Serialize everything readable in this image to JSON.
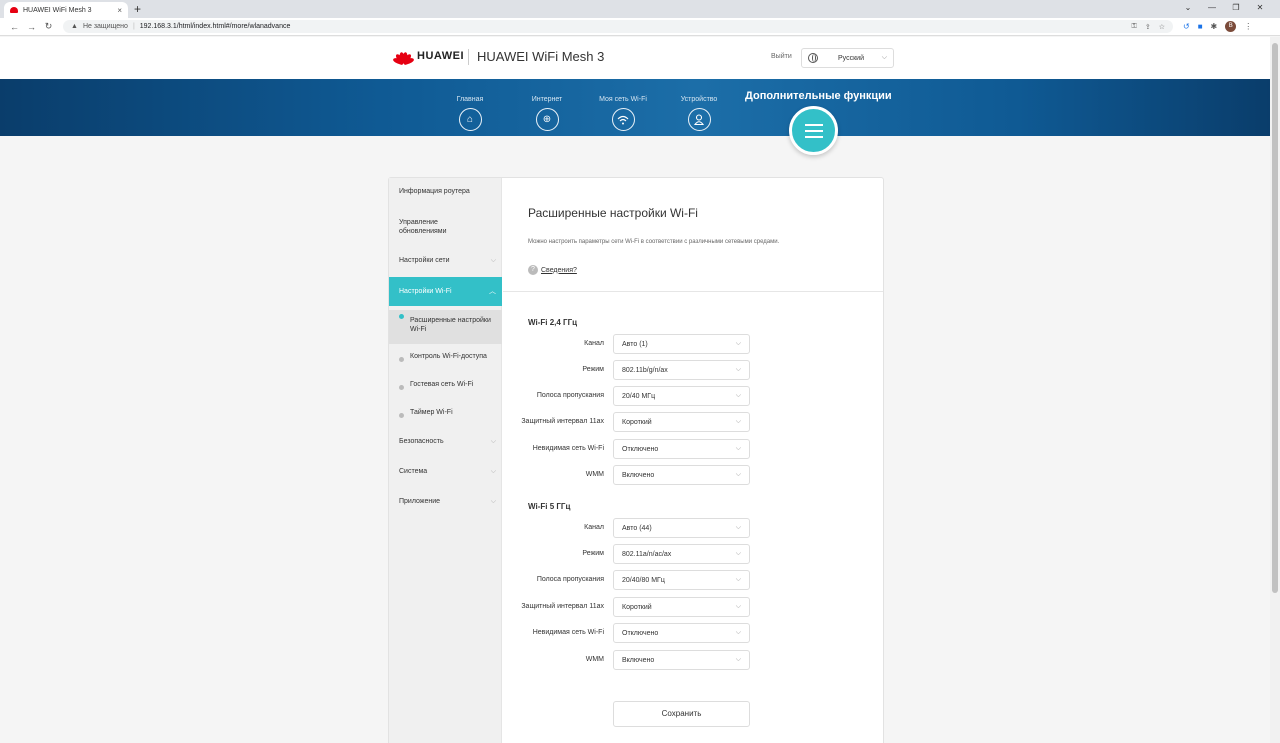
{
  "browser": {
    "tab_title": "HUAWEI WiFi Mesh 3",
    "tab_close": "×",
    "new_tab": "+",
    "security_label": "Не защищено",
    "url": "192.168.3.1/html/index.html#/more/wlanadvance",
    "profile_initial": "B"
  },
  "header": {
    "brand": "HUAWEI",
    "product": "HUAWEI WiFi Mesh 3",
    "logout": "Выйти",
    "language": "Русский"
  },
  "nav": {
    "items": [
      {
        "label": "Главная",
        "icon": "home-icon"
      },
      {
        "label": "Интернет",
        "icon": "globe-icon"
      },
      {
        "label": "Моя сеть Wi-Fi",
        "icon": "wifi-icon"
      },
      {
        "label": "Устройство",
        "icon": "user-icon"
      }
    ],
    "active_label": "Дополнительные функции"
  },
  "sidebar": {
    "items": [
      {
        "label": "Информация роутера"
      },
      {
        "label": "Управление обновлениями"
      },
      {
        "label": "Настройки сети"
      },
      {
        "label": "Настройки Wi-Fi"
      },
      {
        "label": "Безопасность"
      },
      {
        "label": "Система"
      },
      {
        "label": "Приложение"
      }
    ],
    "wifi_sub": [
      {
        "label": "Расширенные настройки Wi-Fi"
      },
      {
        "label": "Контроль Wi-Fi-доступа"
      },
      {
        "label": "Гостевая сеть Wi-Fi"
      },
      {
        "label": "Таймер Wi-Fi"
      }
    ]
  },
  "main": {
    "title": "Расширенные настройки Wi-Fi",
    "description": "Можно настроить параметры сети Wi-Fi в соответствии с различными сетевыми средами.",
    "info_link": "Сведения?",
    "band24": {
      "title": "Wi-Fi 2,4 ГГц",
      "rows": [
        {
          "label": "Канал",
          "value": "Авто (1)"
        },
        {
          "label": "Режим",
          "value": "802.11b/g/n/ax"
        },
        {
          "label": "Полоса пропускания",
          "value": "20/40 МГц"
        },
        {
          "label": "Защитный интервал 11ax",
          "value": "Короткий"
        },
        {
          "label": "Невидимая сеть Wi-Fi",
          "value": "Отключено"
        },
        {
          "label": "WMM",
          "value": "Включено"
        }
      ]
    },
    "band5": {
      "title": "Wi-Fi 5 ГГц",
      "rows": [
        {
          "label": "Канал",
          "value": "Авто (44)"
        },
        {
          "label": "Режим",
          "value": "802.11a/n/ac/ax"
        },
        {
          "label": "Полоса пропускания",
          "value": "20/40/80 МГц"
        },
        {
          "label": "Защитный интервал 11ax",
          "value": "Короткий"
        },
        {
          "label": "Невидимая сеть Wi-Fi",
          "value": "Отключено"
        },
        {
          "label": "WMM",
          "value": "Включено"
        }
      ]
    },
    "save_label": "Сохранить"
  },
  "colors": {
    "accent": "#33c0c8",
    "banner": "#0f5a94",
    "brand_red": "#e60012"
  }
}
